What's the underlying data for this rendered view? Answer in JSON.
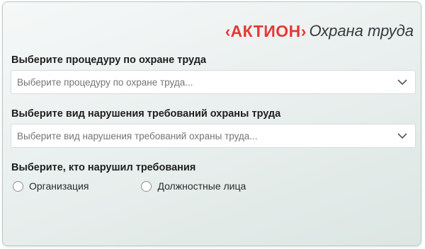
{
  "brand": {
    "left_chevron": "‹",
    "name": "АКТИОН",
    "right_chevron": "›",
    "product": "Охрана труда",
    "brand_color": "#e53935"
  },
  "procedure": {
    "label": "Выберите процедуру по охране труда",
    "placeholder": "Выберите процедуру по охране труда...",
    "icon": "chevron-down-icon"
  },
  "violation": {
    "label": "Выберите вид нарушения требований охраны труда",
    "placeholder": "Выберите вид нарушения требований охраны труда...",
    "icon": "chevron-down-icon"
  },
  "violator": {
    "label": "Выберите, кто нарушил требования",
    "options": [
      {
        "label": "Организация",
        "selected": false
      },
      {
        "label": "Должностные лица",
        "selected": false
      }
    ]
  }
}
